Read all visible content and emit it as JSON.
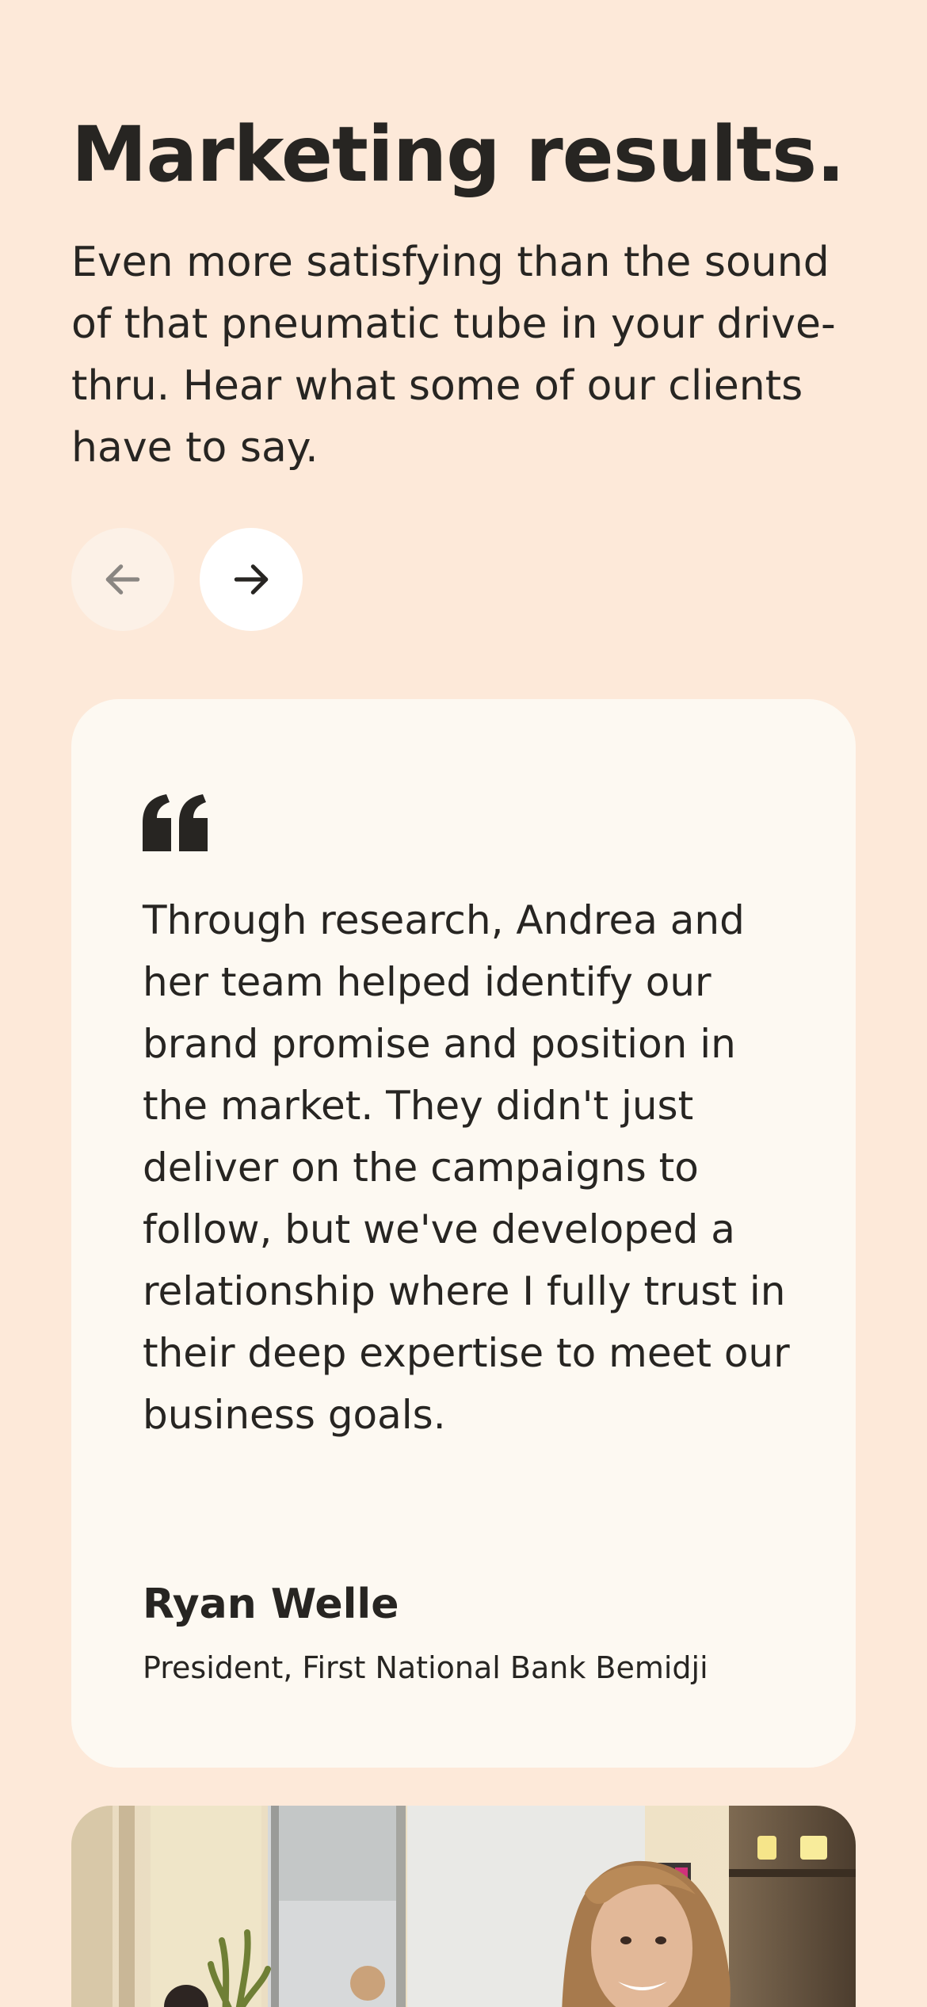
{
  "section": {
    "heading": "Marketing results.",
    "intro": "Even more satisfying than the sound of that pneumatic tube in your drive-thru. Hear what some of our clients have to say."
  },
  "carousel": {
    "prev_icon": "arrow-left-icon",
    "next_icon": "arrow-right-icon"
  },
  "testimonial": {
    "quote_icon": "quote-icon",
    "quote": "Through research, Andrea and her team helped identify our brand promise and position in the market. They didn't just deliver on the campaigns to follow, but we've developed a relationship where I fully trust in their deep expertise to meet our business goals.",
    "author_name": "Ryan Welle",
    "author_title": "President, First National Bank Bemidji"
  },
  "colors": {
    "page_background": "#fde9d9",
    "card_background": "#fdf9f2",
    "text": "#272522",
    "prev_button": "#fcf1e7",
    "next_button": "#ffffff"
  }
}
